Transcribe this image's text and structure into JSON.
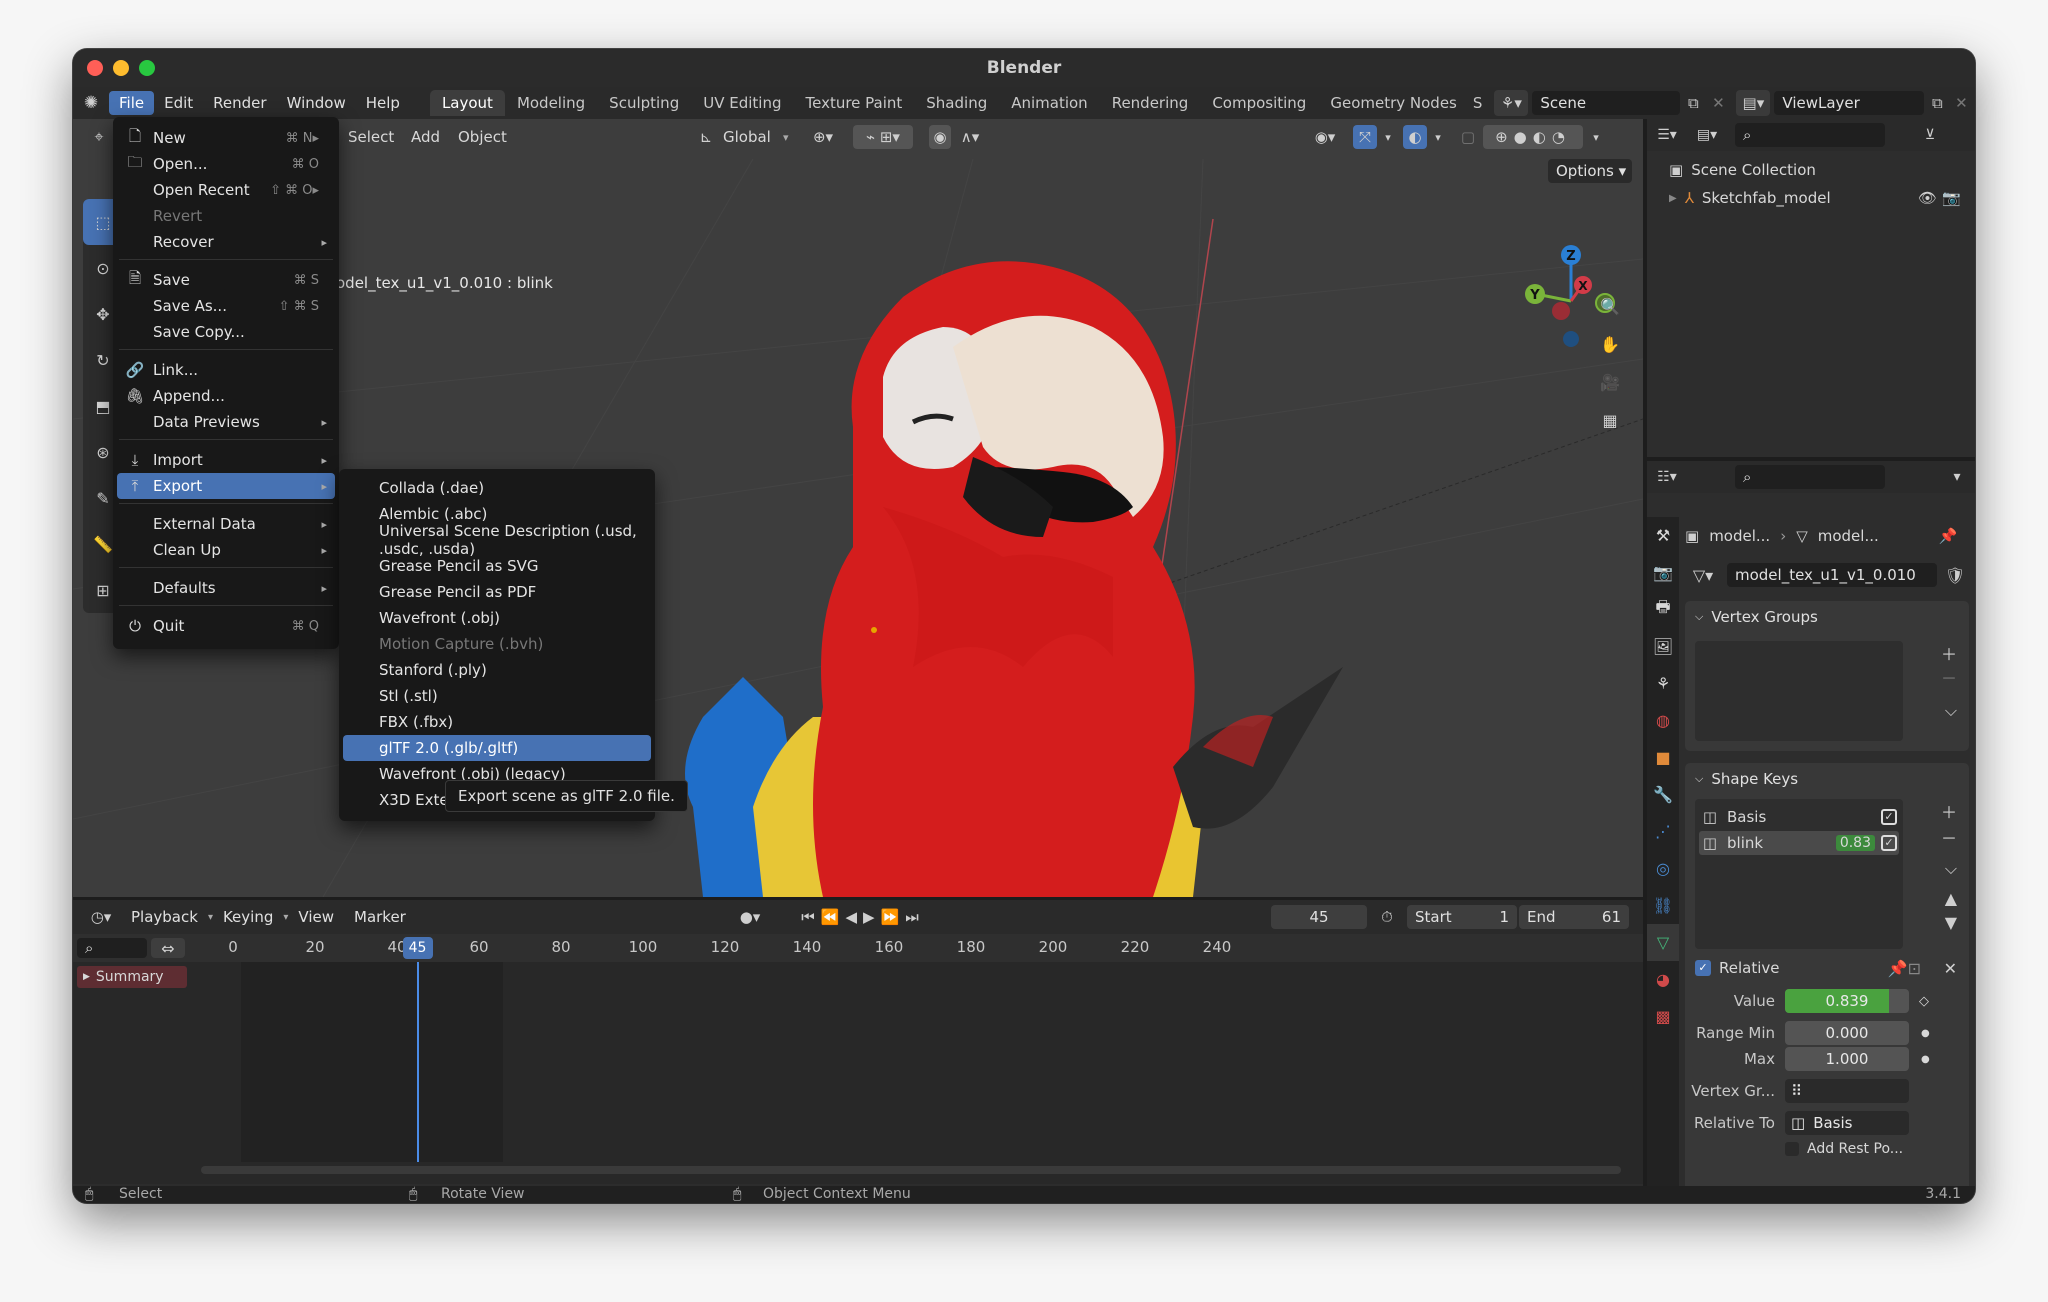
{
  "app": {
    "title": "Blender",
    "version": "3.4.1"
  },
  "menubar": [
    "File",
    "Edit",
    "Render",
    "Window",
    "Help"
  ],
  "workspaces": [
    "Layout",
    "Modeling",
    "Sculpting",
    "UV Editing",
    "Texture Paint",
    "Shading",
    "Animation",
    "Rendering",
    "Compositing",
    "Geometry Nodes",
    "S"
  ],
  "scene": {
    "name": "Scene",
    "view_layer": "ViewLayer"
  },
  "viewport": {
    "header": {
      "select": "Select",
      "add": "Add",
      "object": "Object",
      "orientation": "Global",
      "options": "Options"
    },
    "object_label": "odel_tex_u1_v1_0.010 : blink",
    "gizmo": {
      "z": "Z",
      "y": "Y",
      "x": "X"
    }
  },
  "outliner": {
    "collection": "Scene Collection",
    "items": [
      {
        "label": "Sketchfab_model"
      }
    ]
  },
  "properties": {
    "breadcrumb": [
      "model...",
      "model..."
    ],
    "mesh_name": "model_tex_u1_v1_0.010",
    "vertex_groups_title": "Vertex Groups",
    "shape_keys_title": "Shape Keys",
    "shape_keys": [
      {
        "name": "Basis",
        "value": ""
      },
      {
        "name": "blink",
        "value": "0.83"
      }
    ],
    "relative_label": "Relative",
    "value_label": "Value",
    "value": "0.839",
    "value_fraction": 0.839,
    "range_min_label": "Range Min",
    "range_min": "0.000",
    "max_label": "Max",
    "max": "1.000",
    "vertex_group_label": "Vertex Gr...",
    "relative_to_label": "Relative To",
    "relative_to": "Basis",
    "add_rest_label": "Add Rest Po..."
  },
  "timeline": {
    "header": [
      "Playback",
      "Keying",
      "View",
      "Marker"
    ],
    "current_frame": "45",
    "start_label": "Start",
    "start": "1",
    "end_label": "End",
    "end": "61",
    "ruler": [
      "0",
      "20",
      "40",
      "60",
      "80",
      "100",
      "120",
      "140",
      "160",
      "180",
      "200",
      "220",
      "240"
    ],
    "summary": "Summary"
  },
  "statusbar": {
    "select": "Select",
    "rotate": "Rotate View",
    "context": "Object Context Menu"
  },
  "file_menu": {
    "items": [
      {
        "label": "New",
        "shortcut": "⌘ N▸",
        "icon": "new-file-icon"
      },
      {
        "label": "Open...",
        "shortcut": "⌘ O",
        "icon": "folder-icon"
      },
      {
        "label": "Open Recent",
        "shortcut": "⇧ ⌘ O▸"
      },
      {
        "label": "Revert",
        "shortcut": ""
      },
      {
        "label": "Recover",
        "shortcut": ""
      },
      {
        "label": "Save",
        "shortcut": "⌘ S",
        "icon": "save-icon"
      },
      {
        "label": "Save As...",
        "shortcut": "⇧ ⌘ S"
      },
      {
        "label": "Save Copy...",
        "shortcut": ""
      },
      {
        "label": "Link...",
        "shortcut": "",
        "icon": "link-icon"
      },
      {
        "label": "Append...",
        "shortcut": "",
        "icon": "append-icon"
      },
      {
        "label": "Data Previews",
        "shortcut": ""
      },
      {
        "label": "Import",
        "shortcut": "",
        "icon": "import-icon"
      },
      {
        "label": "Export",
        "shortcut": "",
        "icon": "export-icon"
      },
      {
        "label": "External Data",
        "shortcut": ""
      },
      {
        "label": "Clean Up",
        "shortcut": ""
      },
      {
        "label": "Defaults",
        "shortcut": ""
      },
      {
        "label": "Quit",
        "shortcut": "⌘ Q",
        "icon": "power-icon"
      }
    ]
  },
  "export_menu": {
    "items": [
      "Collada (.dae)",
      "Alembic (.abc)",
      "Universal Scene Description (.usd, .usdc, .usda)",
      "Grease Pencil as SVG",
      "Grease Pencil as PDF",
      "Wavefront (.obj)",
      "Motion Capture (.bvh)",
      "Stanford (.ply)",
      "Stl (.stl)",
      "FBX (.fbx)",
      "glTF 2.0 (.glb/.gltf)",
      "Wavefront (.obj) (legacy)",
      "X3D Exte"
    ],
    "tooltip": "Export scene as glTF 2.0 file."
  }
}
